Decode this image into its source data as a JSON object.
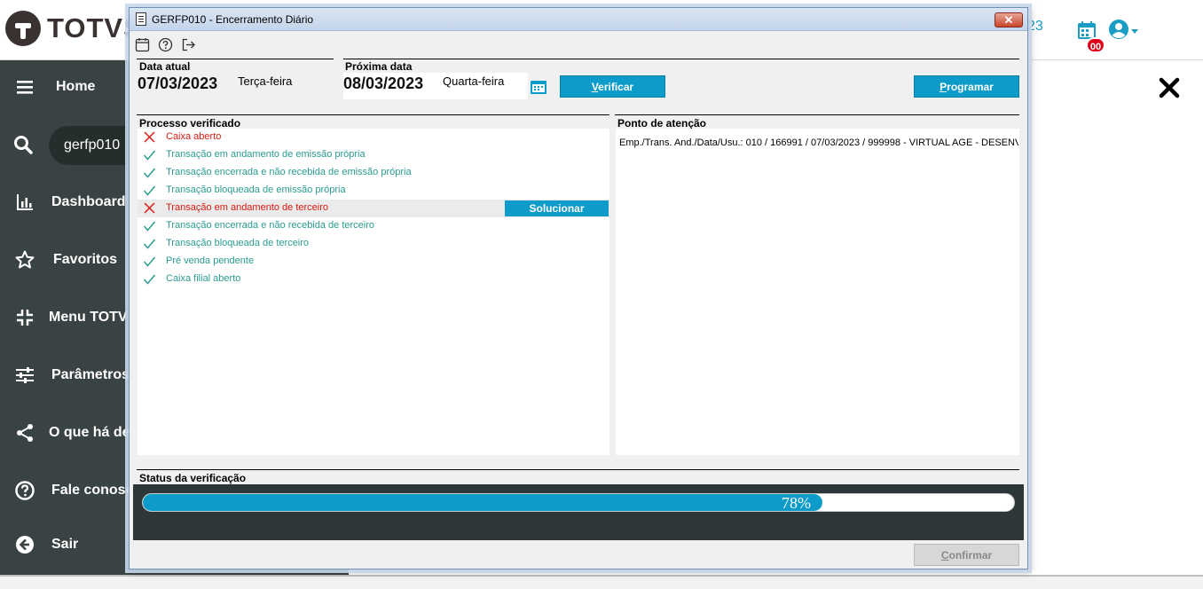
{
  "app": {
    "logo_text": "TOTVS",
    "top_fragment": "23",
    "notification_count": "00"
  },
  "sidebar": {
    "search_value": "gerfp010",
    "items": [
      {
        "label": "Home",
        "icon": "menu-icon"
      },
      {
        "label": "Dashboard",
        "icon": "bar-chart-icon"
      },
      {
        "label": "Favoritos",
        "icon": "star-icon"
      },
      {
        "label": "Menu TOTVS",
        "icon": "collapse-icon"
      },
      {
        "label": "Parâmetros",
        "icon": "sliders-icon"
      },
      {
        "label": "O que há de n",
        "icon": "share-icon"
      },
      {
        "label": "Fale conosco",
        "icon": "help-circle-icon"
      },
      {
        "label": "Sair",
        "icon": "arrow-left-circle-icon"
      }
    ]
  },
  "dialog": {
    "title": "GERFP010 - Encerramento Diário",
    "close_label": "✕",
    "current_date": {
      "label": "Data atual",
      "value": "07/03/2023",
      "weekday": "Terça-feira"
    },
    "next_date": {
      "label": "Próxima data",
      "value": "08/03/2023",
      "weekday": "Quarta-feira"
    },
    "buttons": {
      "verify_first": "V",
      "verify_rest": "erificar",
      "schedule_first": "P",
      "schedule_rest": "rogramar",
      "solve": "Solucionar",
      "confirm_first": "C",
      "confirm_rest": "onfirmar"
    },
    "process": {
      "label": "Processo verificado",
      "items": [
        {
          "text": "Caixa aberto",
          "status": "error"
        },
        {
          "text": "Transação em andamento de emissão própria",
          "status": "ok"
        },
        {
          "text": "Transação encerrada e não recebida de emissão própria",
          "status": "ok"
        },
        {
          "text": "Transação bloqueada de emissão própria",
          "status": "ok"
        },
        {
          "text": "Transação em andamento de terceiro",
          "status": "error"
        },
        {
          "text": "Transação encerrada e não recebida de terceiro",
          "status": "ok"
        },
        {
          "text": "Transação bloqueada de terceiro",
          "status": "ok"
        },
        {
          "text": "Pré venda pendente",
          "status": "ok"
        },
        {
          "text": "Caixa filial aberto",
          "status": "ok"
        }
      ]
    },
    "attention": {
      "label": "Ponto de atenção",
      "text": "Emp./Trans. And./Data/Usu.: 010 / 166991 / 07/03/2023 / 999998 - VIRTUAL AGE - DESENVOL"
    },
    "status": {
      "label": "Status da verificação",
      "progress": 78,
      "progress_text": "78%"
    }
  },
  "colors": {
    "accent": "#0d9cc9",
    "ok": "#2a9b8f",
    "error": "#d91a12",
    "sidebar": "#3a4343"
  }
}
